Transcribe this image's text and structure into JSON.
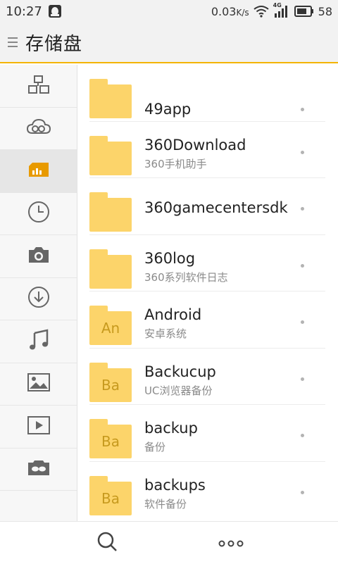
{
  "status_bar": {
    "time": "10:27",
    "net_speed": "0.03",
    "net_unit": "K/s",
    "network_type": "4G",
    "battery": "58",
    "notification_icon": "qq-penguin-icon"
  },
  "app_bar": {
    "title": "存储盘",
    "menu_icon": "menu-icon"
  },
  "sidebar": {
    "items": [
      {
        "icon": "category-icon",
        "active": false
      },
      {
        "icon": "cloud-icon",
        "active": false
      },
      {
        "icon": "sd-card-icon",
        "active": true
      },
      {
        "icon": "recent-clock-icon",
        "active": false
      },
      {
        "icon": "camera-icon",
        "active": false
      },
      {
        "icon": "download-icon",
        "active": false
      },
      {
        "icon": "music-note-icon",
        "active": false
      },
      {
        "icon": "image-icon",
        "active": false
      },
      {
        "icon": "video-icon",
        "active": false
      },
      {
        "icon": "vr-glasses-icon",
        "active": false
      }
    ]
  },
  "files": [
    {
      "name": "49app",
      "desc": "",
      "abbr": ""
    },
    {
      "name": "360Download",
      "desc": "360手机助手",
      "abbr": ""
    },
    {
      "name": "360gamecentersdk",
      "desc": "",
      "abbr": ""
    },
    {
      "name": "360log",
      "desc": "360系列软件日志",
      "abbr": ""
    },
    {
      "name": "Android",
      "desc": "安卓系统",
      "abbr": "An"
    },
    {
      "name": "Backucup",
      "desc": "UC浏览器备份",
      "abbr": "Ba"
    },
    {
      "name": "backup",
      "desc": "备份",
      "abbr": "Ba"
    },
    {
      "name": "backups",
      "desc": "软件备份",
      "abbr": "Ba"
    }
  ],
  "bottom_bar": {
    "search_icon": "search-icon",
    "more_icon": "more-icon"
  },
  "colors": {
    "accent": "#f4b400",
    "folder": "#fcd46a",
    "sd_active": "#e89a00"
  }
}
